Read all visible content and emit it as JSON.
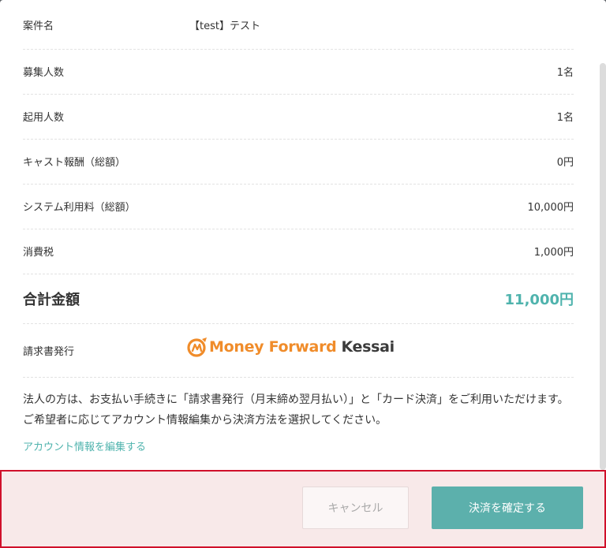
{
  "summary": {
    "project_name_label": "案件名",
    "project_name_value": "【test】テスト",
    "recruit_label": "募集人数",
    "recruit_value": "1名",
    "hired_label": "起用人数",
    "hired_value": "1名",
    "cast_fee_label": "キャスト報酬（総額）",
    "cast_fee_value": "0円",
    "system_fee_label": "システム利用料（総額）",
    "system_fee_value": "10,000円",
    "tax_label": "消費税",
    "tax_value": "1,000円",
    "total_label": "合計金額",
    "total_value": "11,000円",
    "invoice_label": "請求書発行"
  },
  "logo": {
    "part1": "Money Forward",
    "part2": "Kessai",
    "icon": "money-forward-logo-icon"
  },
  "note": "法人の方は、お支払い手続きに「請求書発行（月末締め翌月払い）」と「カード決済」をご利用いただけます。ご希望者に応じてアカウント情報編集から決済方法を選択してください。",
  "account_link": "アカウント情報を編集する",
  "buttons": {
    "cancel": "キャンセル",
    "confirm": "決済を確定する"
  },
  "colors": {
    "accent": "#4fb3ad",
    "confirm_button": "#5cb0ac",
    "logo_orange": "#f08c2a",
    "highlight_border": "#d0102a"
  }
}
